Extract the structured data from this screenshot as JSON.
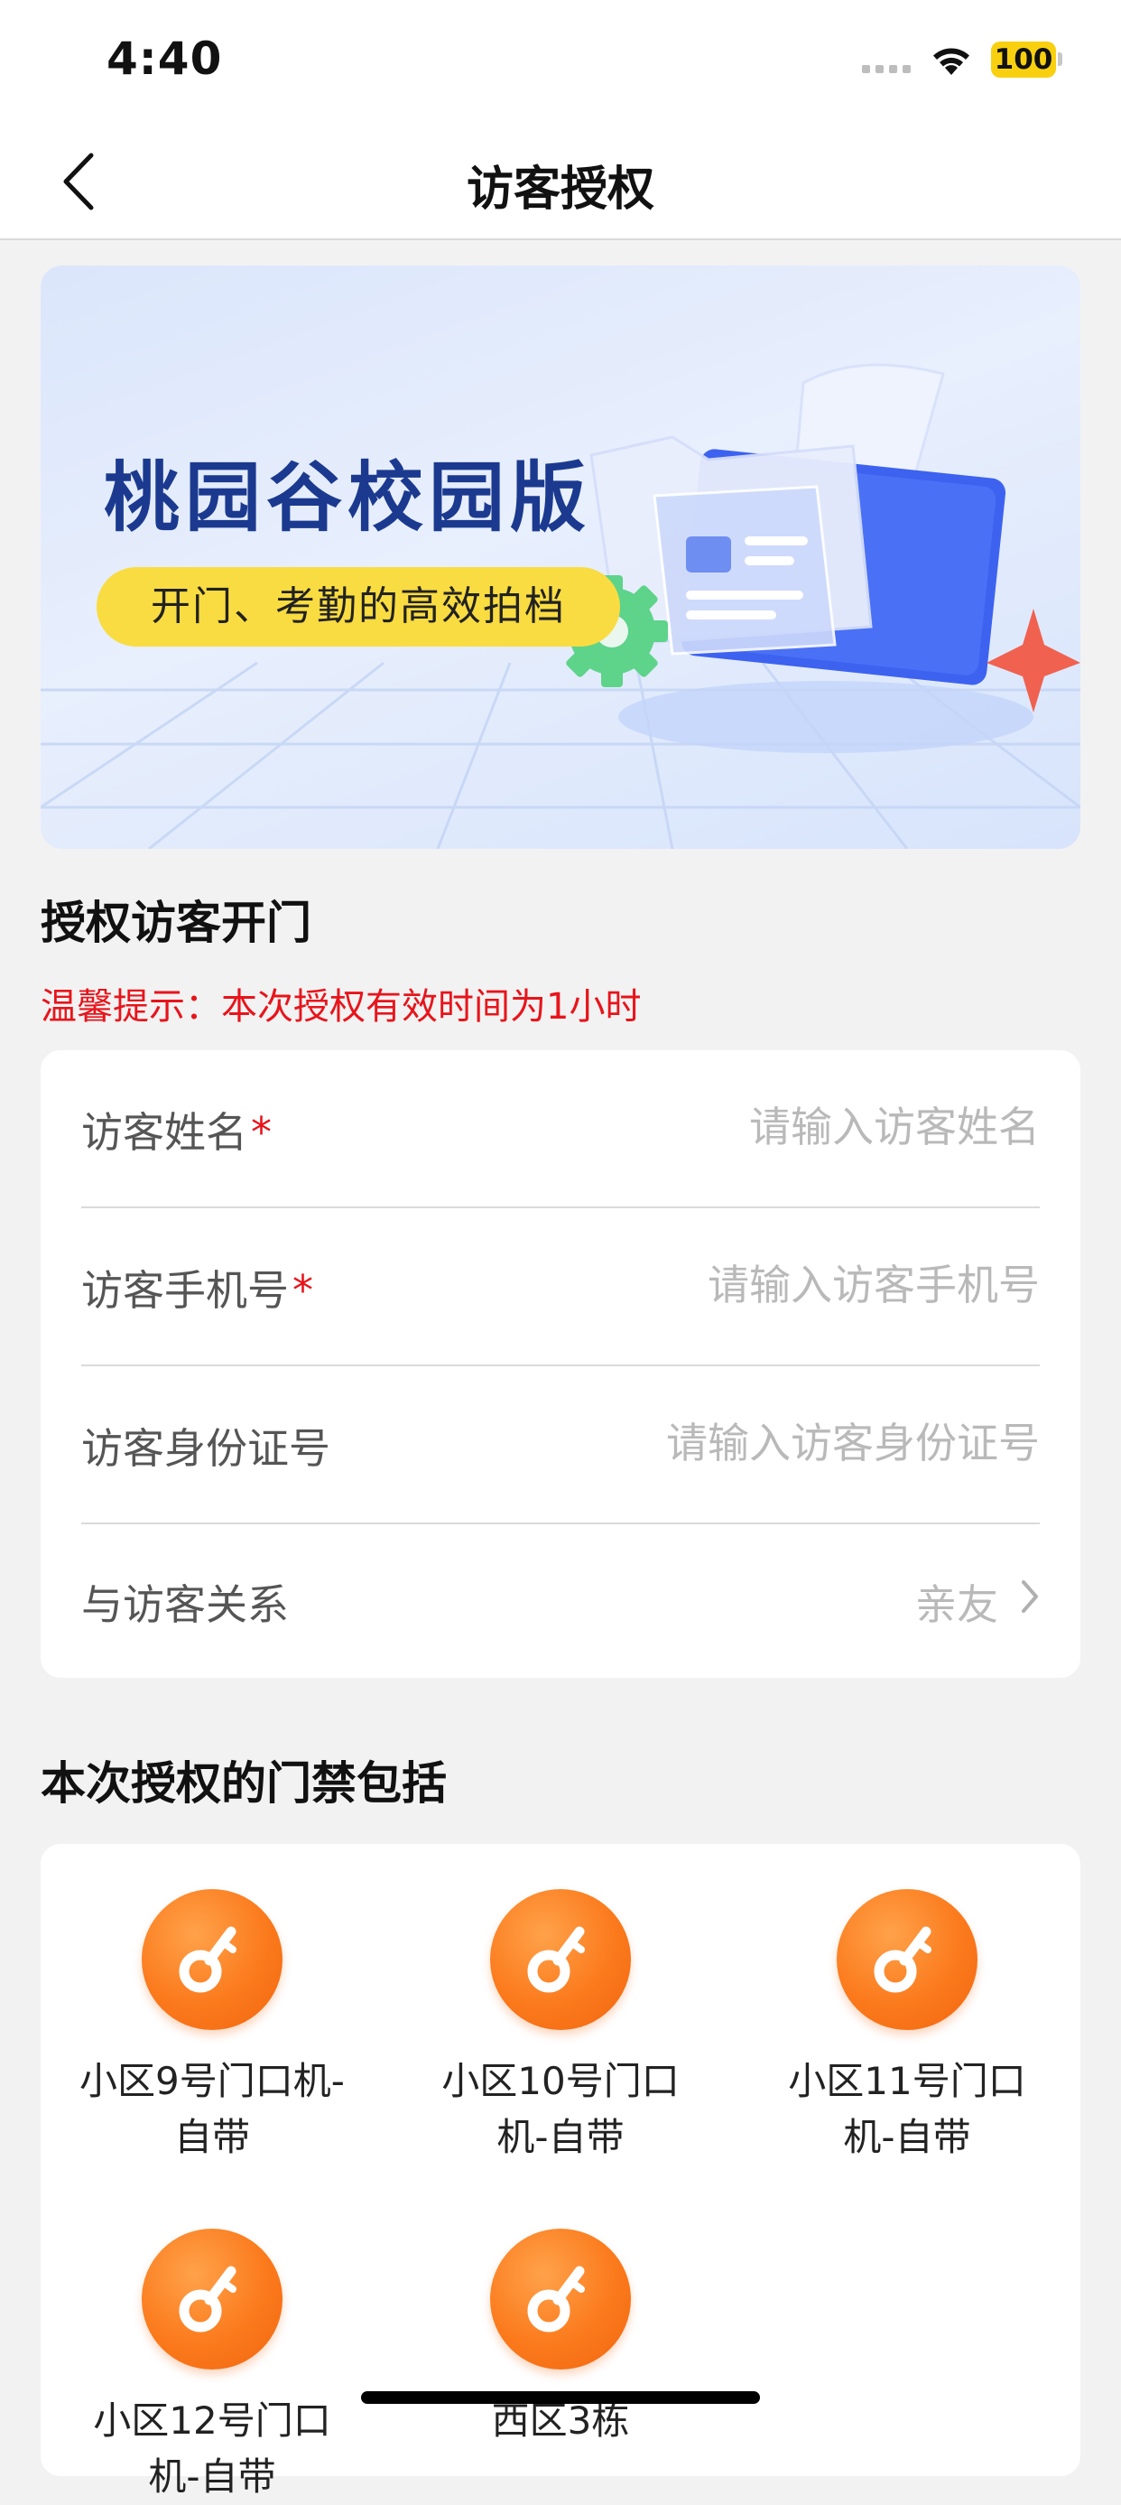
{
  "status_bar": {
    "time": "4:40",
    "battery": "100"
  },
  "nav": {
    "title": "访客授权"
  },
  "banner": {
    "title": "桃园谷校园版",
    "subtitle": "开门、考勤的高效拍档"
  },
  "authorize_section": {
    "title": "授权访客开门",
    "notice": "温馨提示：本次授权有效时间为1小时"
  },
  "form": {
    "name": {
      "label": "访客姓名",
      "required_mark": "*",
      "placeholder": "请输入访客姓名"
    },
    "phone": {
      "label": "访客手机号",
      "required_mark": "*",
      "placeholder": "请输入访客手机号"
    },
    "id_card": {
      "label": "访客身份证号",
      "placeholder": "请输入访客身份证号"
    },
    "relation": {
      "label": "与访客关系",
      "value": "亲友"
    }
  },
  "doors_section": {
    "title": "本次授权的门禁包括",
    "doors": [
      {
        "label": "小区9号门口机-自带"
      },
      {
        "label": "小区10号门口机-自带"
      },
      {
        "label": "小区11号门口机-自带"
      },
      {
        "label": "小区12号门口机-自带"
      },
      {
        "label": "西区3栋"
      }
    ]
  },
  "colors": {
    "accent_orange": "#fb7a1c",
    "warning_red": "#e8141b",
    "banner_blue": "#1b3a8f",
    "pill_yellow": "#f9dc41"
  }
}
